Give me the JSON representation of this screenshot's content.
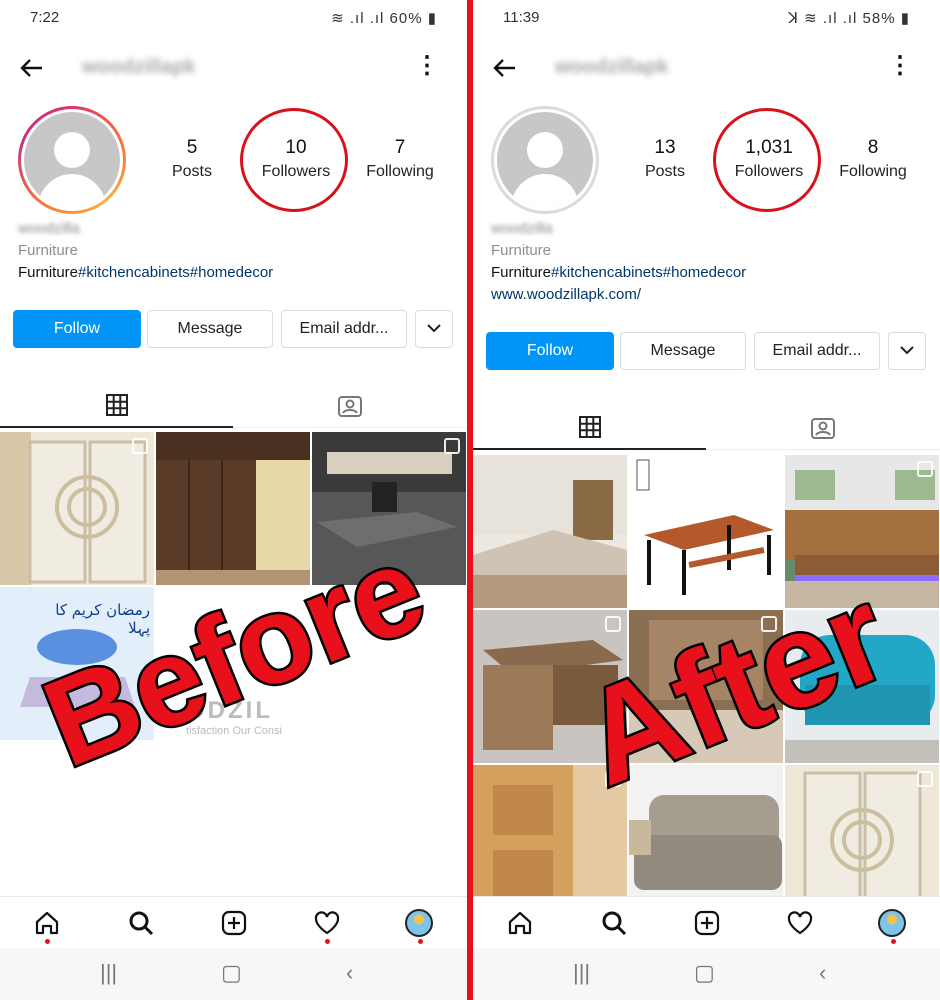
{
  "before": {
    "status": {
      "time": "7:22",
      "battery": "60%"
    },
    "username": "woodzillapk",
    "stats": [
      {
        "value": "5",
        "label": "Posts"
      },
      {
        "value": "10",
        "label": "Followers"
      },
      {
        "value": "7",
        "label": "Following"
      }
    ],
    "bio": {
      "name": "woodzilla",
      "category": "Furniture",
      "text": "Furniture",
      "hashtags": "#kitchencabinets#homedecor"
    },
    "buttons": {
      "follow": "Follow",
      "message": "Message",
      "email": "Email addr..."
    },
    "overlay": "Before",
    "tile_texts": {
      "urdu": "رمضان کریم کا پہلا",
      "brand": "ODZIL",
      "tagline": "tisfaction Our Consi"
    }
  },
  "after": {
    "status": {
      "time": "11:39",
      "battery": "58%"
    },
    "username": "woodzillapk",
    "stats": [
      {
        "value": "13",
        "label": "Posts"
      },
      {
        "value": "1,031",
        "label": "Followers"
      },
      {
        "value": "8",
        "label": "Following"
      }
    ],
    "bio": {
      "name": "woodzilla",
      "category": "Furniture",
      "text": "Furniture",
      "hashtags": "#kitchencabinets#homedecor",
      "link": "www.woodzillapk.com/"
    },
    "buttons": {
      "follow": "Follow",
      "message": "Message",
      "email": "Email addr..."
    },
    "overlay": "After"
  },
  "colors": {
    "follow": "#0095f6",
    "overlay": "#e8101a",
    "circle": "#d8121b",
    "hashtag": "#00376b"
  },
  "icons": [
    "back-arrow-icon",
    "more-icon",
    "grid-icon",
    "tagged-icon",
    "home-icon",
    "search-icon",
    "add-icon",
    "heart-icon",
    "chevron-down-icon"
  ]
}
